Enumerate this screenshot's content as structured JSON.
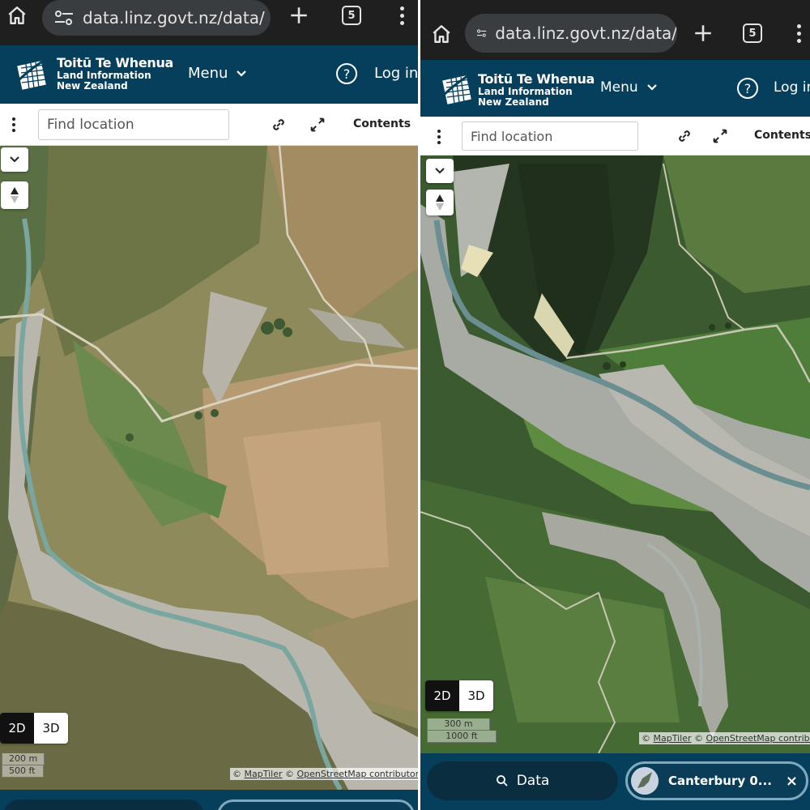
{
  "browser": {
    "url": "data.linz.govt.nz/data/",
    "tab_count": "5"
  },
  "header": {
    "logo_line1": "Toitū Te Whenua",
    "logo_line2": "Land Information",
    "logo_line3": "New Zealand",
    "menu_label": "Menu",
    "login_label_left": "Log in",
    "login_label_right": "Log in"
  },
  "toolbar": {
    "find_placeholder": "Find location",
    "contents_label": "Contents"
  },
  "map_left": {
    "mode_2d": "2D",
    "mode_3d": "3D",
    "scale_metric": "200 m",
    "scale_imperial": "500 ft",
    "attribution_prefix": "© ",
    "maptiler": "MapTiler",
    "attribution_mid": " © ",
    "osm": "OpenStreetMap contributors"
  },
  "map_right": {
    "mode_2d": "2D",
    "mode_3d": "3D",
    "scale_metric": "300 m",
    "scale_imperial": "1000 ft",
    "attribution_prefix": "© ",
    "maptiler": "MapTiler",
    "attribution_mid": " © ",
    "osm": "OpenStreetMap contributors"
  },
  "bottom_bar": {
    "data_label": "Data",
    "layer_label": "Canterbury 0...",
    "close_glyph": "×"
  },
  "colors": {
    "header_bg": "#053f5c",
    "chrome_bg": "#1f1f1f",
    "bottom_pill": "#0a2e40"
  }
}
